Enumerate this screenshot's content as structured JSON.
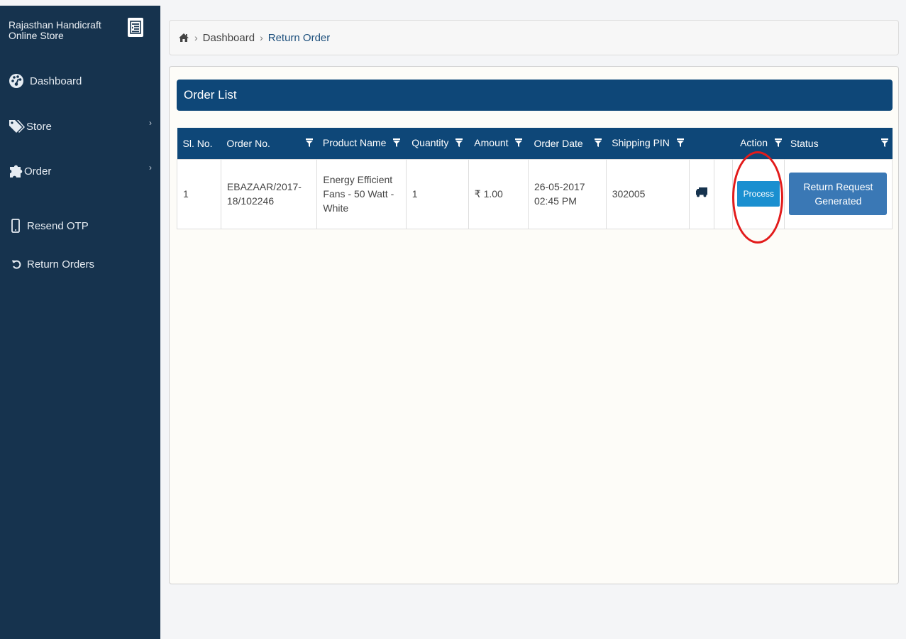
{
  "sidebar": {
    "brand": "Rajasthan Handicraft Online Store",
    "toggle_icon": "menu-toggle-icon",
    "items": [
      {
        "label": "Dashboard",
        "icon": "dashboard-icon"
      },
      {
        "label": "Store",
        "icon": "tag-icon",
        "chevron": "›"
      },
      {
        "label": "Order",
        "icon": "puzzle-icon",
        "chevron": "›"
      },
      {
        "label": "Resend OTP",
        "icon": "mobile-icon"
      },
      {
        "label": "Return Orders",
        "icon": "undo-icon"
      }
    ]
  },
  "breadcrumb": {
    "home_icon": "home-icon",
    "separator": "›",
    "items": [
      "Dashboard",
      "Return Order"
    ]
  },
  "panel": {
    "title": "Order List"
  },
  "table": {
    "columns": [
      "Sl. No.",
      "Order No.",
      "Product Name",
      "Quantity",
      "Amount",
      "Order Date",
      "Shipping PIN",
      "",
      "",
      "Action",
      "Status"
    ],
    "rows": [
      {
        "sl_no": "1",
        "order_no": "EBAZAAR/2017-18/102246",
        "product_name": "Energy Efficient Fans - 50 Watt - White",
        "quantity": "1",
        "amount": "₹ 1.00",
        "order_date": "26-05-2017 02:45 PM",
        "shipping_pin": "302005",
        "ship_icon": "truck-icon",
        "action_label": "Process",
        "status_label": "Return Request Generated"
      }
    ]
  },
  "colors": {
    "sidebar_bg": "#16334e",
    "header_blue": "#0e4778",
    "process_button": "#1a8fd0",
    "status_button": "#3a78b5",
    "annotation_red": "#e21b1b"
  }
}
